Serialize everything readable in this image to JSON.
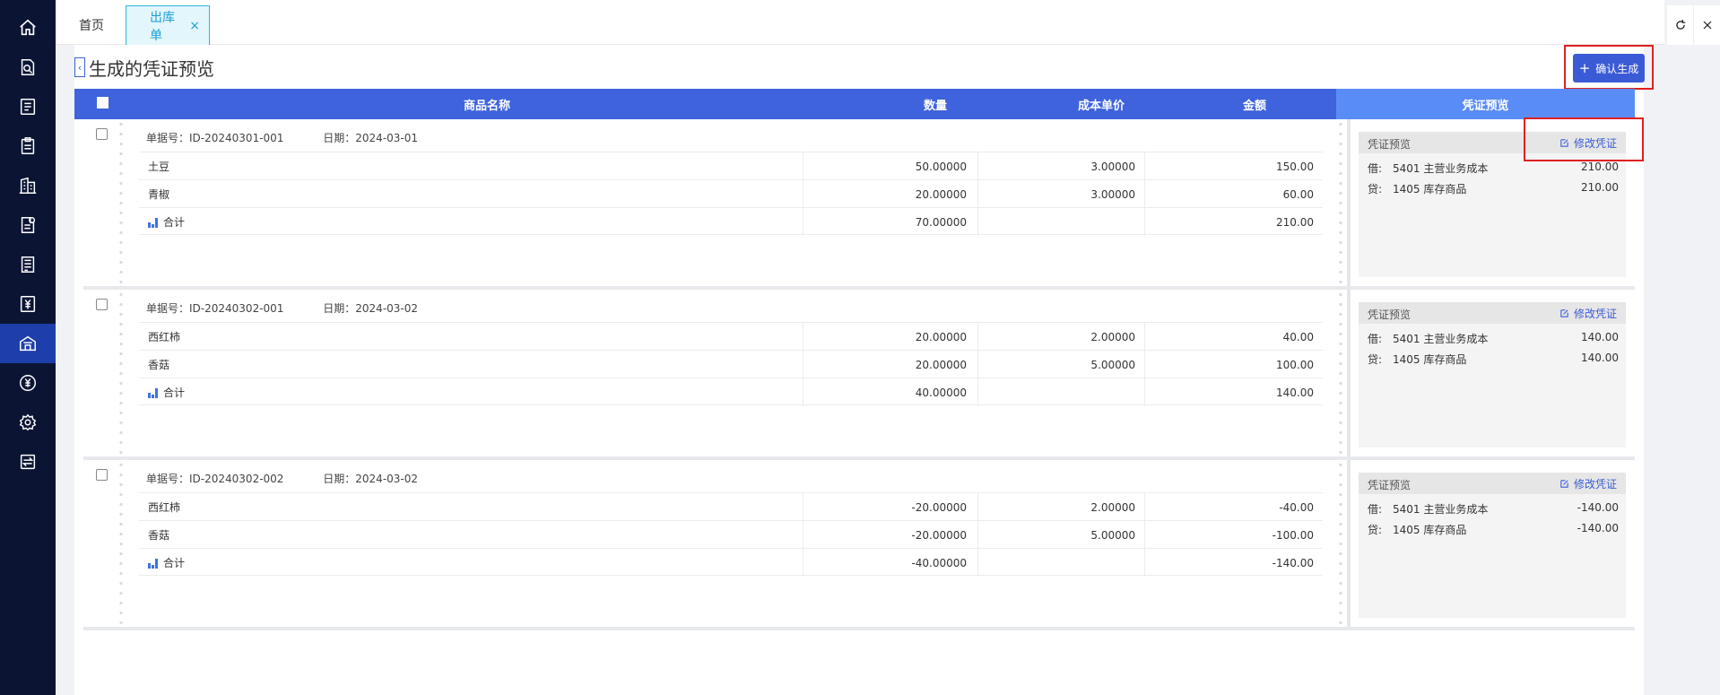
{
  "tabs": {
    "home": "首页",
    "active": "出库单",
    "close": "×"
  },
  "page": {
    "back": "‹",
    "title": "生成的凭证预览",
    "confirm_plus": "+",
    "confirm": "确认生成"
  },
  "header": {
    "name": "商品名称",
    "qty": "数量",
    "price": "成本单价",
    "amount": "金额",
    "voucher": "凭证预览"
  },
  "labels": {
    "order_no": "单据号：",
    "date": "日期：",
    "voucher_title": "凭证预览",
    "edit_voucher": "修改凭证",
    "debit": "借:",
    "credit": "贷:"
  },
  "icons": {
    "sidebar": [
      "home-icon",
      "search-doc-icon",
      "list-icon",
      "clipboard-icon",
      "building-icon",
      "settings-doc-icon",
      "document-icon",
      "yen-icon",
      "warehouse-icon",
      "yen-circle-icon",
      "gear-icon",
      "transfer-icon"
    ],
    "active_sidebar_index": 8
  },
  "colors": {
    "sidebar_bg": "#0b1533",
    "sidebar_active": "#1d3eab",
    "header_bg": "#3f63dc",
    "voucher_header_bg": "#5a8cf7",
    "primary": "#3b5bd6",
    "highlight": "#e02020"
  },
  "groups": [
    {
      "order_no": "ID-20240301-001",
      "date": "2024-03-01",
      "rows": [
        {
          "name": "土豆",
          "qty": "50.00000",
          "price": "3.00000",
          "amount": "150.00"
        },
        {
          "name": "青椒",
          "qty": "20.00000",
          "price": "3.00000",
          "amount": "60.00"
        }
      ],
      "total": {
        "label": "合计",
        "qty": "70.00000",
        "amount": "210.00"
      },
      "voucher": {
        "debit": {
          "account": "5401 主营业务成本",
          "amount": "210.00"
        },
        "credit": {
          "account": "1405 库存商品",
          "amount": "210.00"
        }
      }
    },
    {
      "order_no": "ID-20240302-001",
      "date": "2024-03-02",
      "rows": [
        {
          "name": "西红柿",
          "qty": "20.00000",
          "price": "2.00000",
          "amount": "40.00"
        },
        {
          "name": "香菇",
          "qty": "20.00000",
          "price": "5.00000",
          "amount": "100.00"
        }
      ],
      "total": {
        "label": "合计",
        "qty": "40.00000",
        "amount": "140.00"
      },
      "voucher": {
        "debit": {
          "account": "5401 主营业务成本",
          "amount": "140.00"
        },
        "credit": {
          "account": "1405 库存商品",
          "amount": "140.00"
        }
      }
    },
    {
      "order_no": "ID-20240302-002",
      "date": "2024-03-02",
      "rows": [
        {
          "name": "西红柿",
          "qty": "-20.00000",
          "price": "2.00000",
          "amount": "-40.00"
        },
        {
          "name": "香菇",
          "qty": "-20.00000",
          "price": "5.00000",
          "amount": "-100.00"
        }
      ],
      "total": {
        "label": "合计",
        "qty": "-40.00000",
        "amount": "-140.00"
      },
      "voucher": {
        "debit": {
          "account": "5401 主营业务成本",
          "amount": "-140.00"
        },
        "credit": {
          "account": "1405 库存商品",
          "amount": "-140.00"
        }
      }
    }
  ]
}
